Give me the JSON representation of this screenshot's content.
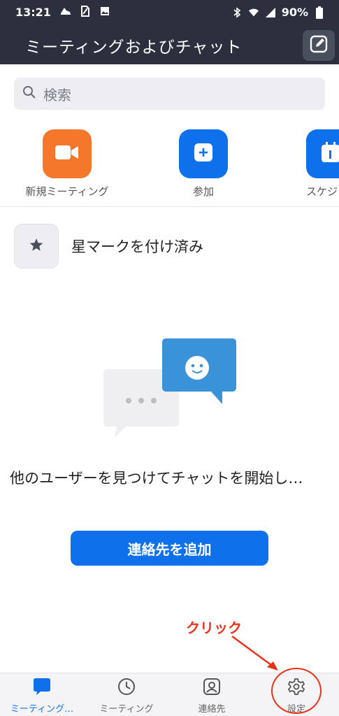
{
  "status_bar": {
    "time": "13:21",
    "battery": "90%",
    "left_icons": [
      "shoe-icon",
      "sim-icon",
      "image-icon"
    ],
    "right_icons": [
      "bluetooth-icon",
      "wifi-icon",
      "signal-icon",
      "battery-icon"
    ]
  },
  "header": {
    "title": "ミーティングおよびチャット",
    "compose_icon": "compose-icon"
  },
  "search": {
    "placeholder": "検索"
  },
  "actions": [
    {
      "label": "新規ミーティング",
      "icon": "video-camera-icon",
      "color": "#f5772b"
    },
    {
      "label": "参加",
      "icon": "plus-icon",
      "color": "#0e71eb"
    },
    {
      "label": "スケジ",
      "icon": "calendar-icon",
      "color": "#0e71eb"
    }
  ],
  "starred": {
    "label": "星マークを付け済み",
    "icon": "star-icon"
  },
  "empty_state": {
    "message": "他のユーザーを見つけてチャットを開始し…",
    "button": "連絡先を追加"
  },
  "annotation": {
    "text": "クリック",
    "color": "#e8331b"
  },
  "bottom_nav": [
    {
      "label": "ミーティング…",
      "icon": "chat-bubble-icon",
      "active": true
    },
    {
      "label": "ミーティング",
      "icon": "clock-icon",
      "active": false
    },
    {
      "label": "連絡先",
      "icon": "contact-icon",
      "active": false
    },
    {
      "label": "設定",
      "icon": "gear-icon",
      "active": false
    }
  ],
  "colors": {
    "header_bg": "#2b2f3e",
    "accent": "#0e71eb"
  }
}
